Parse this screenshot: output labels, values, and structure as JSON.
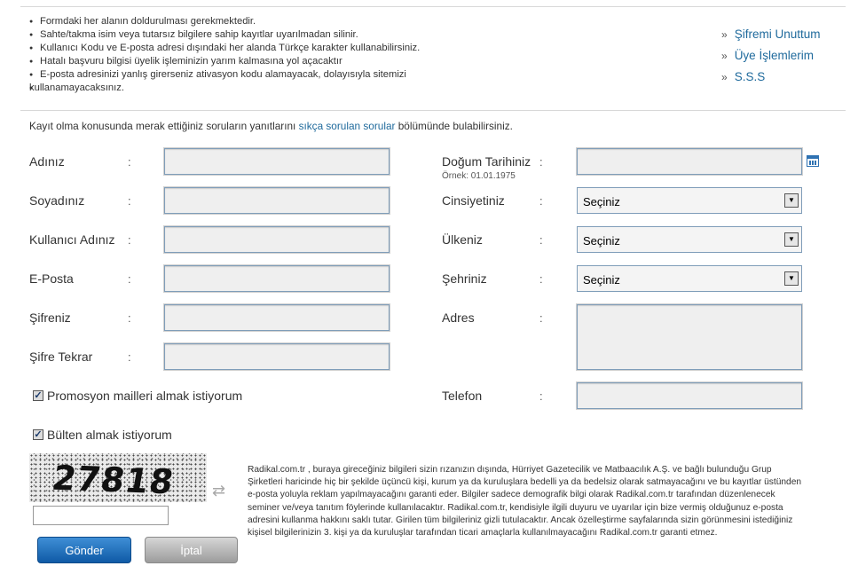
{
  "notes": [
    "Formdaki her alanın doldurulması gerekmektedir.",
    "Sahte/takma isim veya tutarsız bilgilere sahip kayıtlar uyarılmadan silinir.",
    "Kullanıcı Kodu ve E-posta adresi dışındaki her alanda Türkçe karakter kullanabilirsiniz.",
    "Hatalı başvuru bilgisi üyelik işleminizin yarım kalmasına yol açacaktır",
    "E-posta adresinizi yanlış girerseniz ativasyon kodu alamayacak, dolayısıyla sitemizi",
    "kullanamayacaksınız."
  ],
  "side_links": {
    "arrow": "»",
    "items": [
      "Şifremi Unuttum",
      "Üye İşlemlerim",
      "S.S.S"
    ]
  },
  "intro": {
    "before": "Kayıt olma konusunda merak ettiğiniz soruların yanıtlarını ",
    "link": "sıkça sorulan sorular",
    "after": " bölümünde bulabilirsiniz."
  },
  "colon": ":",
  "left_fields": {
    "name": "Adınız",
    "surname": "Soyadınız",
    "username": "Kullanıcı Adınız",
    "email": "E-Posta",
    "password": "Şifreniz",
    "password_repeat": "Şifre Tekrar"
  },
  "right_fields": {
    "birthdate": "Doğum Tarihiniz",
    "birthdate_hint": "Örnek: 01.01.1975",
    "gender": "Cinsiyetiniz",
    "country": "Ülkeniz",
    "city": "Şehriniz",
    "address": "Adres",
    "phone": "Telefon",
    "select_default": "Seçiniz",
    "select_arrow": "▼"
  },
  "checkboxes": {
    "promo": "Promosyon mailleri almak istiyorum",
    "bulletin": "Bülten almak istiyorum",
    "mark": "✓"
  },
  "captcha": {
    "code": "27818",
    "refresh": "⇄"
  },
  "disclaimer": "Radikal.com.tr , buraya gireceğiniz bilgileri sizin rızanızın dışında, Hürriyet Gazetecilik ve Matbaacılık A.Ş. ve bağlı bulunduğu Grup Şirketleri haricinde hiç bir şekilde üçüncü kişi, kurum ya da kuruluşlara bedelli ya da bedelsiz olarak satmayacağını ve bu kayıtlar üstünden e-posta yoluyla reklam yapılmayacağını garanti eder. Bilgiler sadece demografik bilgi olarak Radikal.com.tr tarafından düzenlenecek seminer ve/veya tanıtım föylerinde kullanılacaktır. Radikal.com.tr, kendisiyle ilgili duyuru ve uyarılar için bize vermiş olduğunuz e-posta adresini kullanma hakkını saklı tutar. Girilen tüm bilgileriniz gizli tutulacaktır. Ancak özelleştirme sayfalarında sizin görünmesini istediğiniz kişisel bilgilerinizin 3. kişi ya da kuruluşlar tarafından ticari amaçlarla kullanılmayacağını Radikal.com.tr garanti etmez.",
  "buttons": {
    "submit": "Gönder",
    "cancel": "İptal"
  },
  "colors": {
    "link": "#1f6a9c",
    "submit": "#1a6bb8",
    "cancel": "#b0b0b0"
  }
}
